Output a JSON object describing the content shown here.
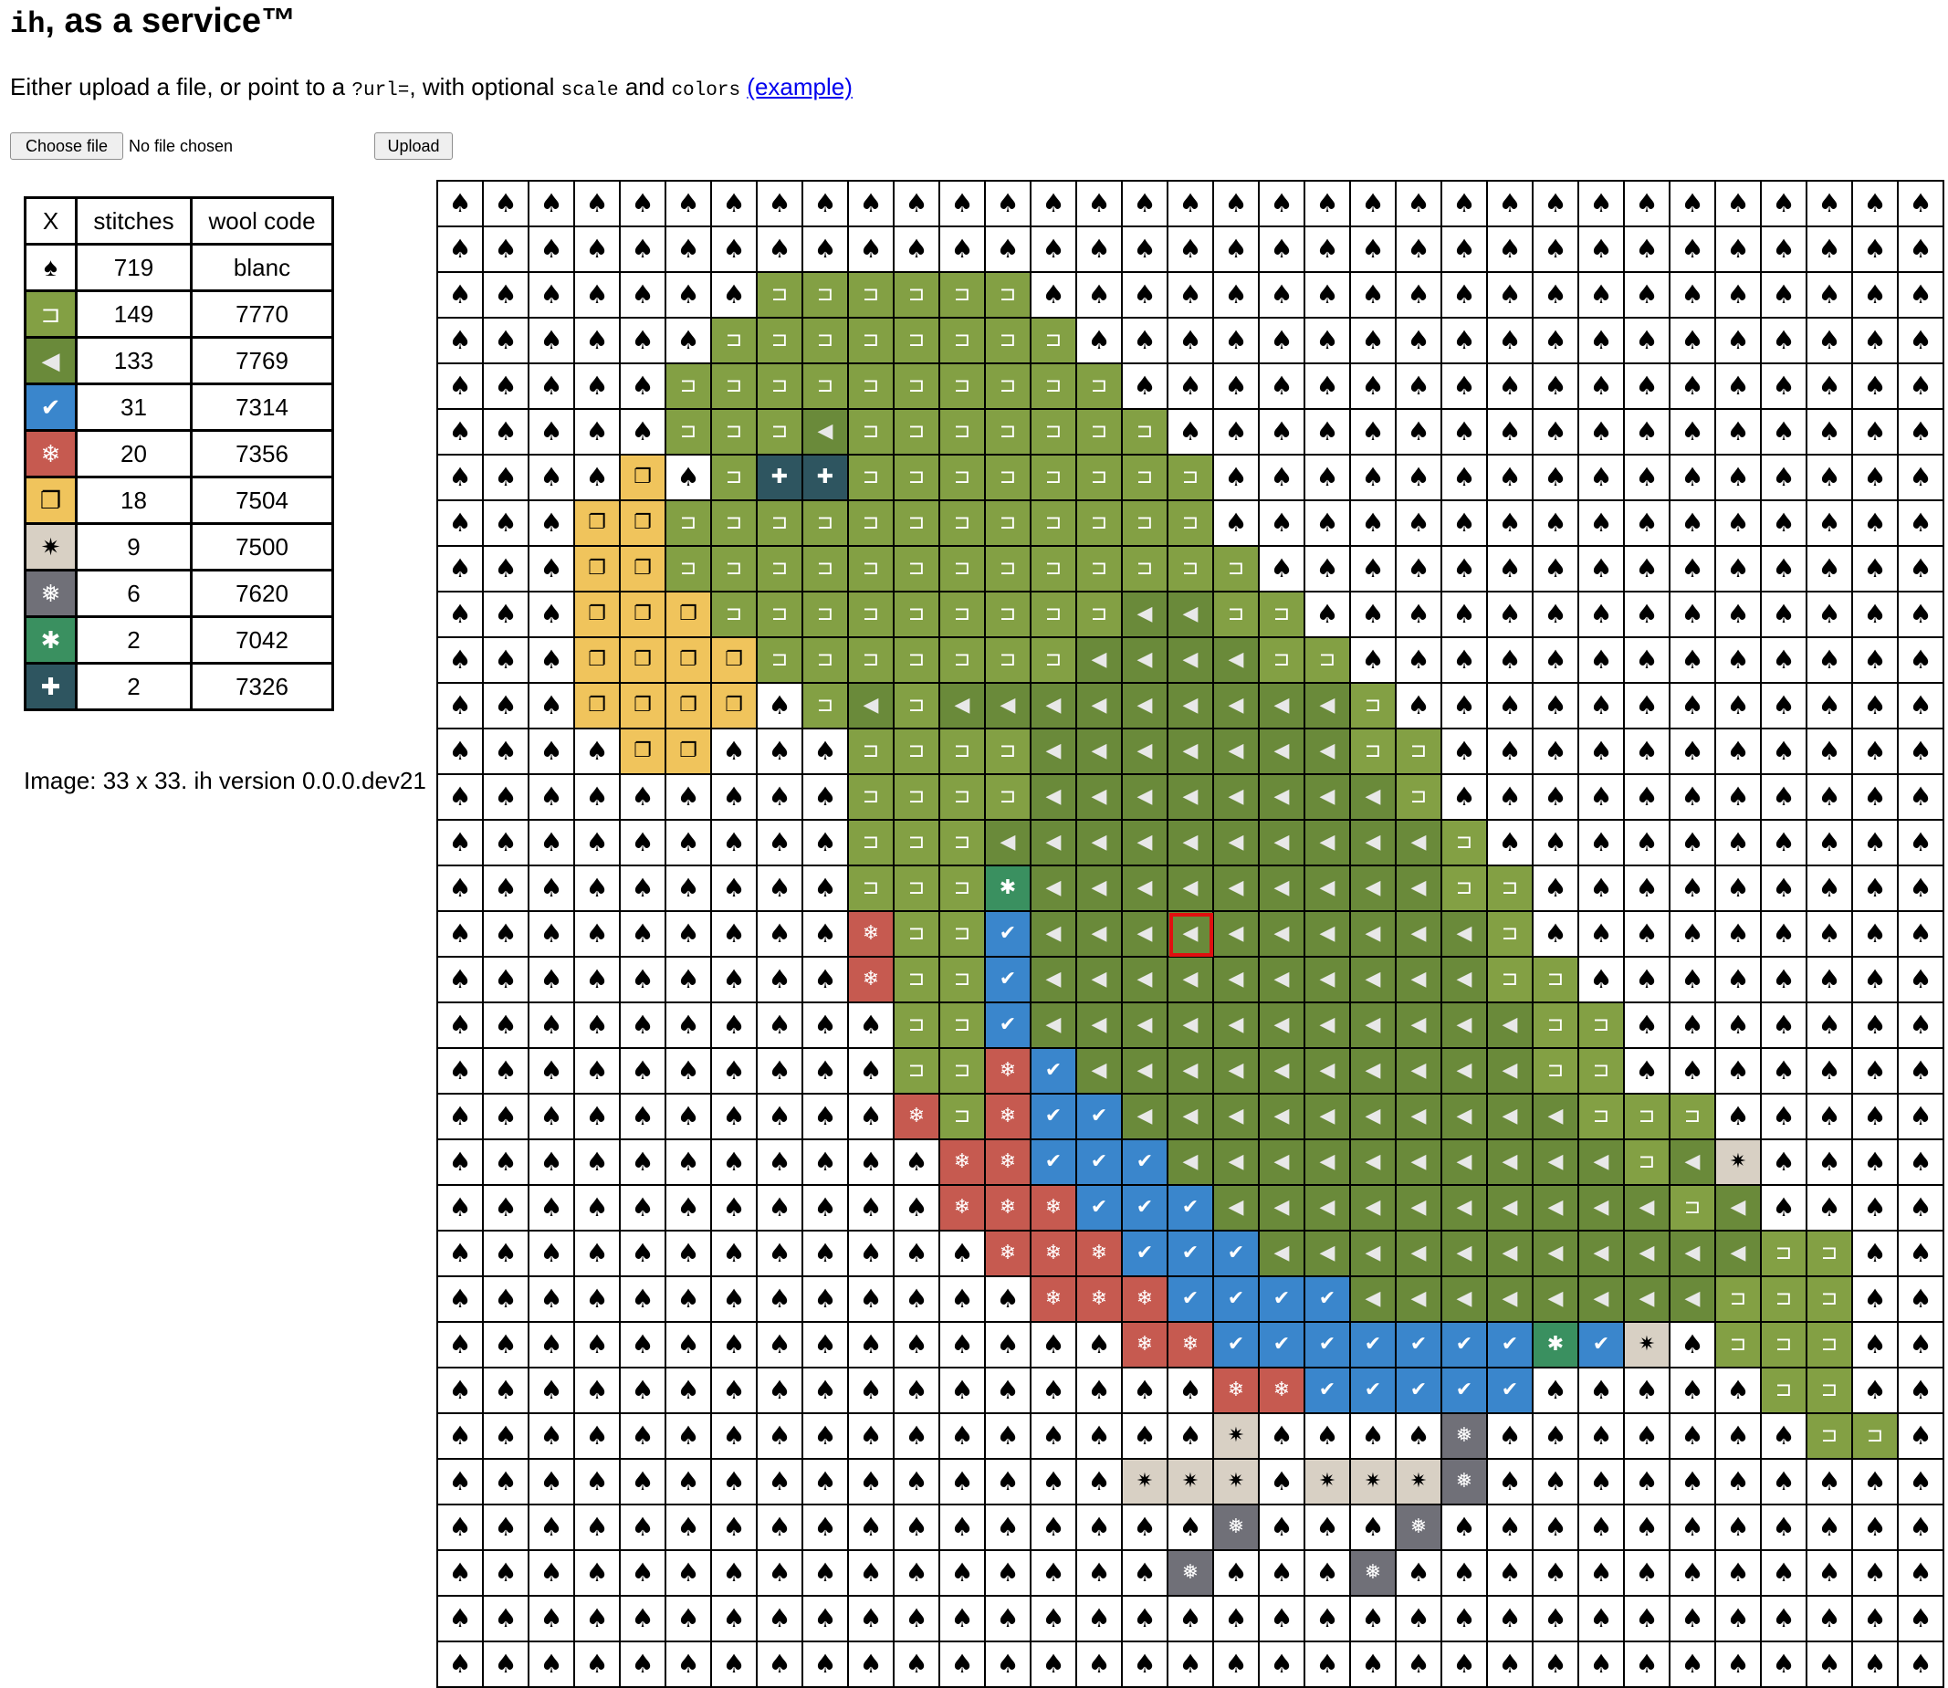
{
  "header": {
    "title_code": "ih",
    "title_rest": ", as a service™"
  },
  "intro": {
    "text_before": "Either upload a file, or point to a ",
    "code_url": "?url=",
    "text_middle": ", with optional ",
    "code_scale": "scale",
    "text_and": " and ",
    "code_colors": "colors",
    "link_label": "(example)"
  },
  "upload_form": {
    "choose_label": "Choose file",
    "file_status": "No file chosen",
    "upload_label": "Upload"
  },
  "legend": {
    "headers": {
      "symbol": "X",
      "stitches": "stitches",
      "wool_code": "wool code"
    },
    "rows": [
      {
        "key": "S",
        "symbol": "♠",
        "icon": "spade-icon",
        "color": "#ffffff",
        "text_color": "#000000",
        "stitches": "719",
        "wool_code": "blanc"
      },
      {
        "key": "A",
        "symbol": "⊐",
        "icon": "square-bracket-icon",
        "color": "#83a044",
        "text_color": "#ffffff",
        "stitches": "149",
        "wool_code": "7770"
      },
      {
        "key": "B",
        "symbol": "◀",
        "icon": "left-triangle-icon",
        "color": "#6a8a3a",
        "text_color": "#e8e8e8",
        "stitches": "133",
        "wool_code": "7769"
      },
      {
        "key": "C",
        "symbol": "✔",
        "icon": "check-icon",
        "color": "#3a86cc",
        "text_color": "#ffffff",
        "stitches": "31",
        "wool_code": "7314"
      },
      {
        "key": "D",
        "symbol": "❄",
        "icon": "snowflake-icon",
        "color": "#c65a50",
        "text_color": "#ffffff",
        "stitches": "20",
        "wool_code": "7356"
      },
      {
        "key": "E",
        "symbol": "❐",
        "icon": "shadowed-square-icon",
        "color": "#f0c45c",
        "text_color": "#000000",
        "stitches": "18",
        "wool_code": "7504"
      },
      {
        "key": "F",
        "symbol": "✷",
        "icon": "star-burst-icon",
        "color": "#d8d0c4",
        "text_color": "#000000",
        "stitches": "9",
        "wool_code": "7500"
      },
      {
        "key": "G",
        "symbol": "❅",
        "icon": "small-snowflake-icon",
        "color": "#707078",
        "text_color": "#ffffff",
        "stitches": "6",
        "wool_code": "7620"
      },
      {
        "key": "H",
        "symbol": "✱",
        "icon": "asterisk-icon",
        "color": "#3a9060",
        "text_color": "#ffffff",
        "stitches": "2",
        "wool_code": "7042"
      },
      {
        "key": "I",
        "symbol": "✚",
        "icon": "cross-icon",
        "color": "#2e5560",
        "text_color": "#ffffff",
        "stitches": "2",
        "wool_code": "7326"
      }
    ]
  },
  "image_info": "Image: 33 x 33. ih version 0.0.0.dev21",
  "pattern": {
    "columns": 33,
    "rows_count": 33,
    "selected_cell": [
      16,
      16
    ],
    "rows": [
      "SSSSSSSSSSSSSSSSSSSSSSSSSSSSSSSSS",
      "SSSSSSSSSSSSSSSSSSSSSSSSSSSSSSSSS",
      "SSSSSSSAAAAAASSSSSSSSSSSSSSSSSSSS",
      "SSSSSSAAAAAAAASSSSSSSSSSSSSSSSSSS",
      "SSSSSAAAAAAAAAASSSSSSSSSSSSSSSSSS",
      "SSSSSAAABAAAAAAASSSSSSSSSSSSSSSSS",
      "SSSSESAIIAAAAAAAASSSSSSSSSSSSSSSS",
      "SSSEEAAAAAAAAAAAASSSSSSSSSSSSSSSS",
      "SSSEEAAAAAAAAAAAAASSSSSSSSSSSSSSS",
      "SSSEEEAAAAAAAAABBAASSSSSSSSSSSSSS",
      "SSSEEEEAAAAAAABBBBAASSSSSSSSSSSSS",
      "SSSEEEESABABBBBBBBBBASSSSSSSSSSSS",
      "SSSSEESSSAAAABBBBBBBAASSSSSSSSSSS",
      "SSSSSSSSSAAAABBBBBBBBASSSSSSSSSSS",
      "SSSSSSSSSAAABBBBBBBBBBASSSSSSSSSS",
      "SSSSSSSSSAAAHBBBBBBBBBAASSSSSSSSS",
      "SSSSSSSSSDAACBBBBBBBBBBASSSSSSSSS",
      "SSSSSSSSSDAACBBBBBBBBBBAASSSSSSSS",
      "SSSSSSSSSSAACBBBBBBBBBBBAASSSSSSS",
      "SSSSSSSSSSAADCBBBBBBBBBBAASSSSSSS",
      "SSSSSSSSSSDADCCBBBBBBBBBBAAASSSSS",
      "SSSSSSSSSSSDDCCCBBBBBBBBBBABFSSSS",
      "SSSSSSSSSSSDDDCCCBBBBBBBBBBABSSSS",
      "SSSSSSSSSSSSDDDCCCBBBBBBBBBBBAASS",
      "SSSSSSSSSSSSSDDDCCCCBBBBBBBBAAASS",
      "SSSSSSSSSSSSSSSDDCCCCCCCHCFSAAASS",
      "SSSSSSSSSSSSSSSSSDDCCCCCSSSSSAASS",
      "SSSSSSSSSSSSSSSSSFSSSSGSSSSSSSAAS",
      "SSSSSSSSSSSSSSSFFFSFFFGSSSSSSSSSS",
      "SSSSSSSSSSSSSSSSSGSSSGSSSSSSSSSSS",
      "SSSSSSSSSSSSSSSSGSSSGSSSSSSSSSSSS",
      "SSSSSSSSSSSSSSSSSSSSSSSSSSSSSSSSS",
      "SSSSSSSSSSSSSSSSSSSSSSSSSSSSSSSSS"
    ]
  }
}
